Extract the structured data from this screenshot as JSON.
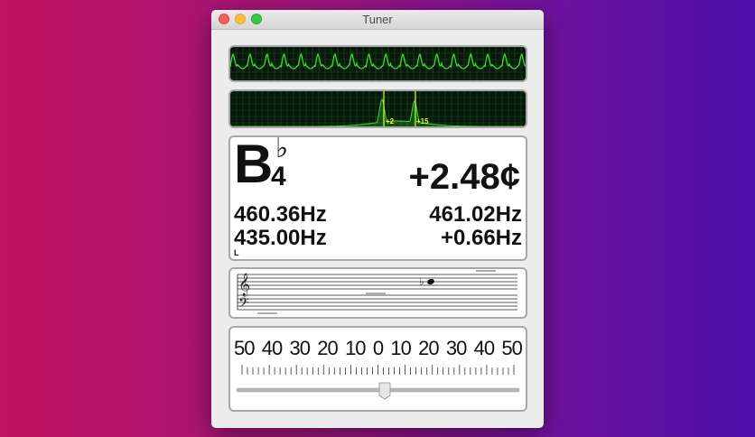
{
  "window": {
    "title": "Tuner"
  },
  "scope": {
    "trace_color": "#38e02a",
    "grid_color": "#1f4a22"
  },
  "spectrum": {
    "peak_labels": [
      "+2",
      "+15"
    ],
    "peak_color": "#e6ff2a"
  },
  "readout": {
    "note": "B",
    "accidental": "♭",
    "octave": "4",
    "cents": "+2.48¢",
    "measured_freq": "460.36Hz",
    "reference_freq": "461.02Hz",
    "standard_pitch": "435.00Hz",
    "freq_diff": "+0.66Hz",
    "flag": "L"
  },
  "staff": {
    "accidental": "♭"
  },
  "meter": {
    "scale_labels": [
      "50",
      "40",
      "30",
      "20",
      "10",
      "0",
      "10",
      "20",
      "30",
      "40",
      "50"
    ],
    "deviation": 2.48,
    "range": [
      -50,
      50
    ]
  }
}
